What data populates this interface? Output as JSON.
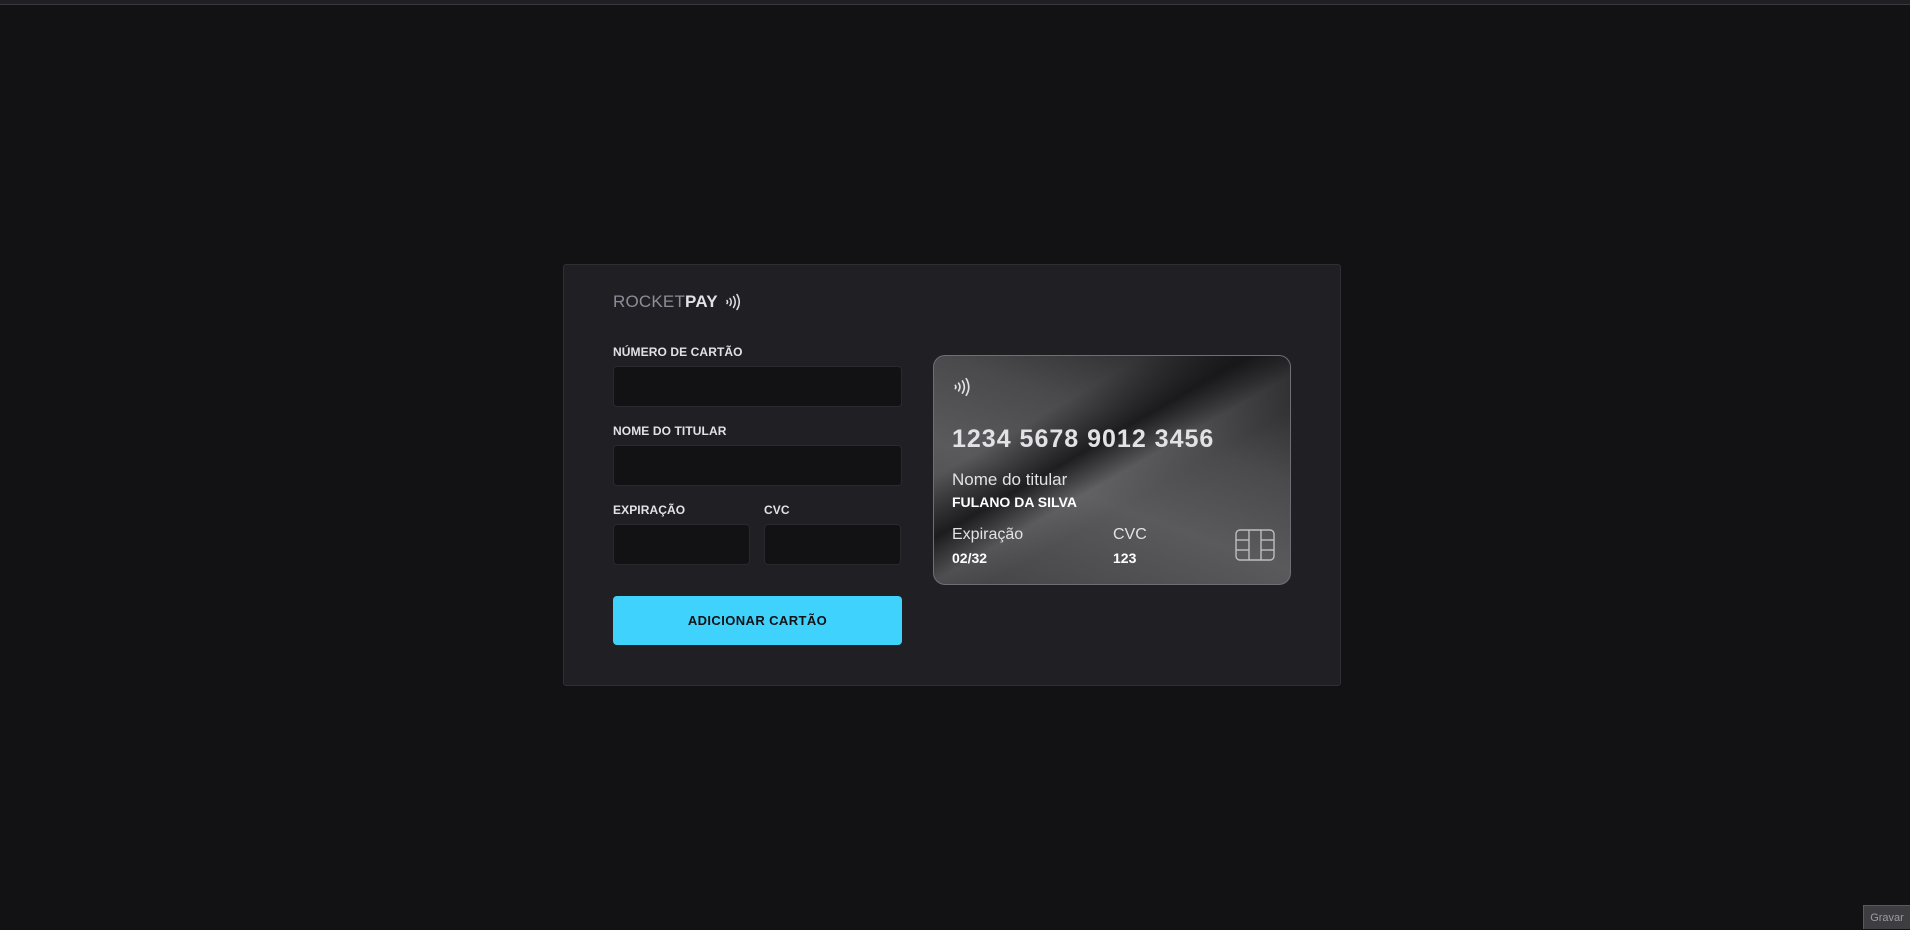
{
  "logo": {
    "part1": "ROCKET",
    "part2": "PAY",
    "icon": "contactless-icon"
  },
  "form": {
    "card_number_label": "NÚMERO DE CARTÃO",
    "card_number_value": "",
    "holder_label": "NOME DO TITULAR",
    "holder_value": "",
    "expiration_label": "EXPIRAÇÃO",
    "expiration_value": "",
    "cvc_label": "CVC",
    "cvc_value": "",
    "submit_label": "ADICIONAR CARTÃO"
  },
  "card": {
    "contactless_icon": "contactless-icon",
    "number": "1234 5678 9012 3456",
    "holder_label": "Nome do titular",
    "holder_value": "FULANO DA SILVA",
    "expiration_label": "Expiração",
    "expiration_value": "02/32",
    "cvc_label": "CVC",
    "cvc_value": "123",
    "chip_icon": "chip-icon"
  },
  "overlay": {
    "record_label": "Gravar"
  },
  "colors": {
    "background": "#121214",
    "panel": "#202024",
    "accent": "#3fd2fd",
    "text": "#e1e1e6"
  }
}
